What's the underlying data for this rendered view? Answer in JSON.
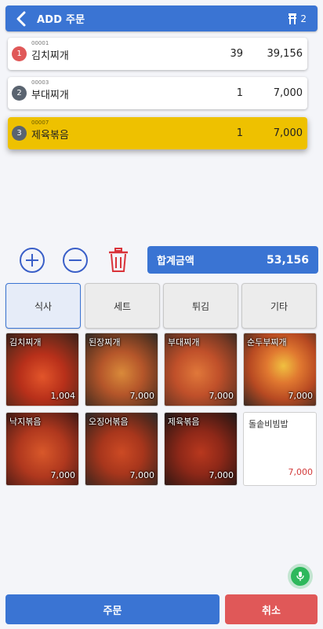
{
  "header": {
    "title": "ADD 주문",
    "table_number": "2"
  },
  "order_items": [
    {
      "index": "1",
      "code": "00001",
      "name": "김치찌개",
      "qty": "39",
      "amount": "39,156",
      "badge_color": "#e05858"
    },
    {
      "index": "2",
      "code": "00003",
      "name": "부대찌개",
      "qty": "1",
      "amount": "7,000",
      "badge_color": "#5a6470"
    },
    {
      "index": "3",
      "code": "00007",
      "name": "제육볶음",
      "qty": "1",
      "amount": "7,000",
      "badge_color": "#5a6470"
    }
  ],
  "controls": {
    "plus": "plus-circle-icon",
    "minus": "minus-circle-icon",
    "delete": "trash-icon"
  },
  "total": {
    "label": "합계금액",
    "value": "53,156"
  },
  "categories": [
    {
      "label": "식사",
      "active": true
    },
    {
      "label": "세트",
      "active": false
    },
    {
      "label": "튀김",
      "active": false
    },
    {
      "label": "기타",
      "active": false
    }
  ],
  "menu_items": [
    {
      "name": "김치찌개",
      "price": "1,004"
    },
    {
      "name": "된장찌개",
      "price": "7,000"
    },
    {
      "name": "부대찌개",
      "price": "7,000"
    },
    {
      "name": "순두부찌개",
      "price": "7,000"
    },
    {
      "name": "낙지볶음",
      "price": "7,000"
    },
    {
      "name": "오징어볶음",
      "price": "7,000"
    },
    {
      "name": "제육볶음",
      "price": "7,000"
    },
    {
      "name": "돌솥비빔밥",
      "price": "7,000"
    }
  ],
  "buttons": {
    "order": "주문",
    "cancel": "취소"
  },
  "colors": {
    "primary": "#3a74d3",
    "selected_row": "#eec100",
    "cancel": "#e05858",
    "control_icon": "#3a5fc8",
    "trash_icon": "#d9333a",
    "mic": "#2eb85c"
  }
}
